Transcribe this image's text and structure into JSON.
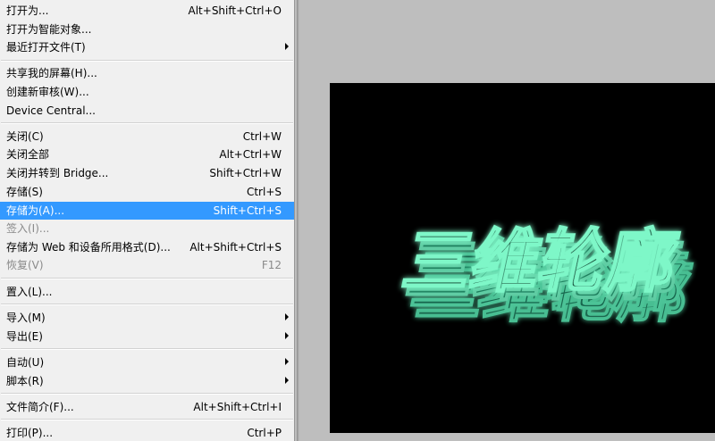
{
  "menu": {
    "items": [
      {
        "label": "打开为...",
        "shortcut": "Alt+Shift+Ctrl+O"
      },
      {
        "label": "打开为智能对象...",
        "shortcut": ""
      },
      {
        "label": "最近打开文件(T)",
        "shortcut": "",
        "submenu": true
      },
      {
        "label": "共享我的屏幕(H)...",
        "shortcut": ""
      },
      {
        "label": "创建新审核(W)...",
        "shortcut": ""
      },
      {
        "label": "Device Central...",
        "shortcut": ""
      },
      {
        "label": "关闭(C)",
        "shortcut": "Ctrl+W"
      },
      {
        "label": "关闭全部",
        "shortcut": "Alt+Ctrl+W"
      },
      {
        "label": "关闭并转到 Bridge...",
        "shortcut": "Shift+Ctrl+W"
      },
      {
        "label": "存储(S)",
        "shortcut": "Ctrl+S"
      },
      {
        "label": "存储为(A)...",
        "shortcut": "Shift+Ctrl+S",
        "highlighted": true
      },
      {
        "label": "签入(I)...",
        "shortcut": "",
        "disabled": true
      },
      {
        "label": "存储为 Web 和设备所用格式(D)...",
        "shortcut": "Alt+Shift+Ctrl+S"
      },
      {
        "label": "恢复(V)",
        "shortcut": "F12",
        "disabled": true
      },
      {
        "label": "置入(L)...",
        "shortcut": ""
      },
      {
        "label": "导入(M)",
        "shortcut": "",
        "submenu": true
      },
      {
        "label": "导出(E)",
        "shortcut": "",
        "submenu": true
      },
      {
        "label": "自动(U)",
        "shortcut": "",
        "submenu": true
      },
      {
        "label": "脚本(R)",
        "shortcut": "",
        "submenu": true
      },
      {
        "label": "文件简介(F)...",
        "shortcut": "Alt+Shift+Ctrl+I"
      },
      {
        "label": "打印(P)...",
        "shortcut": "Ctrl+P"
      }
    ]
  },
  "colors": {
    "highlight": "#3399ff",
    "menu_bg": "#f0f0f0",
    "workspace_bg": "#bebebe",
    "canvas_bg": "#000000",
    "glow_text": "#3fd39a"
  },
  "canvas": {
    "artwork": "glowing green 3D chinese text",
    "art_text": "三维轮廓"
  }
}
